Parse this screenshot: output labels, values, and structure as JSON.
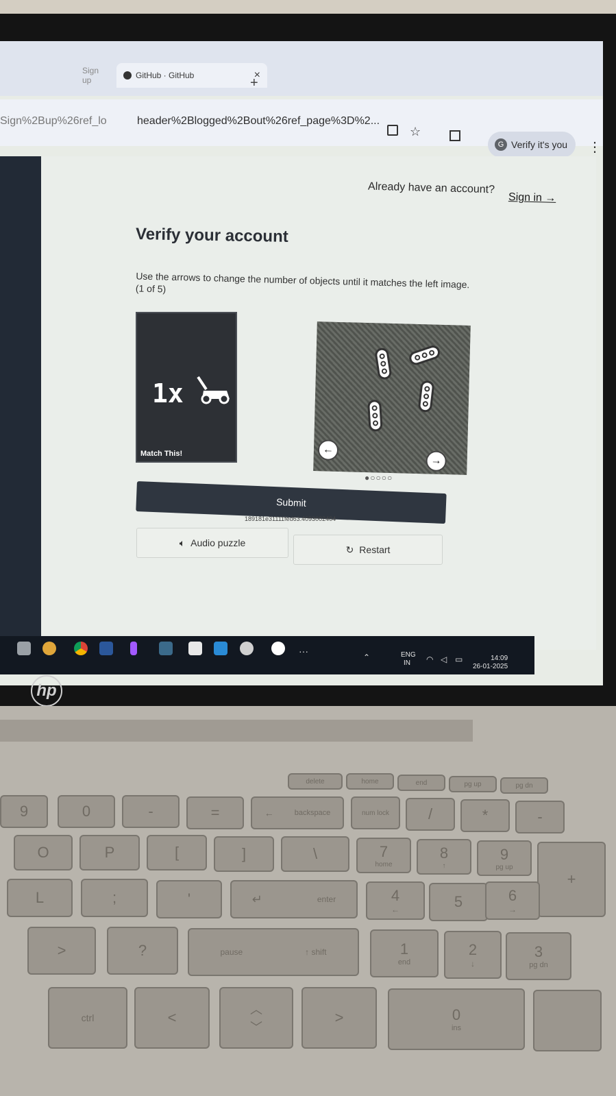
{
  "browser": {
    "tabs": [
      {
        "label": "Sign up"
      },
      {
        "label": "GitHub · GitHub",
        "close": "×"
      }
    ],
    "new_tab": "+",
    "url_left": "Sign%2Bup%26ref_lo",
    "url_right": "header%2Blogged%2Bout%26ref_page%3D%2...",
    "profile_initial": "G",
    "profile_label": "Verify it's you",
    "window_controls": {
      "minimize": "–",
      "restore": "□",
      "close": "×"
    }
  },
  "page": {
    "already_text": "Already have an account?",
    "signin_link": "Sign in →",
    "title": "Verify your account",
    "instruction": "Use the arrows to change the number of objects until it matches the left image. (1 of 5)",
    "target_count": "1x",
    "match_label": "Match This!",
    "progress_dots": "●○○○○",
    "submit_label": "Submit",
    "session_id": "189181e31111fed63.4093002404",
    "audio_label": "Audio puzzle",
    "restart_label": "Restart",
    "prev_arrow": "←",
    "next_arrow": "→"
  },
  "taskbar": {
    "lang_line1": "ENG",
    "lang_line2": "IN",
    "time": "14:09",
    "date": "26-01-2025"
  },
  "laptop": {
    "brand": "hp",
    "keys": {
      "row1": [
        "9",
        "0",
        "-",
        "=",
        "←",
        "backspace",
        "num lock",
        "/",
        "*",
        "-"
      ],
      "row2": [
        "O",
        "P",
        "[",
        "]",
        "\\",
        "7",
        "8",
        "9",
        "+"
      ],
      "row2_sub": {
        "7": "home",
        "8": "↑",
        "9": "pg up"
      },
      "row3": [
        "L",
        ";",
        "'",
        "↵",
        "enter",
        "4",
        "5",
        "6"
      ],
      "row3_sub": {
        "4": "←",
        "6": "→"
      },
      "row4": [
        ">",
        "?",
        "pause",
        "↑ shift",
        "1",
        "2",
        "3"
      ],
      "row4_sub": {
        "1": "end",
        "2": "↓",
        "3": "pg dn"
      },
      "row5": [
        "ctrl",
        "<",
        ">",
        "0"
      ],
      "row5_sub": {
        "0": "ins"
      },
      "fn_row": [
        "delete",
        "home",
        "end",
        "pg up",
        "pg dn"
      ]
    }
  }
}
